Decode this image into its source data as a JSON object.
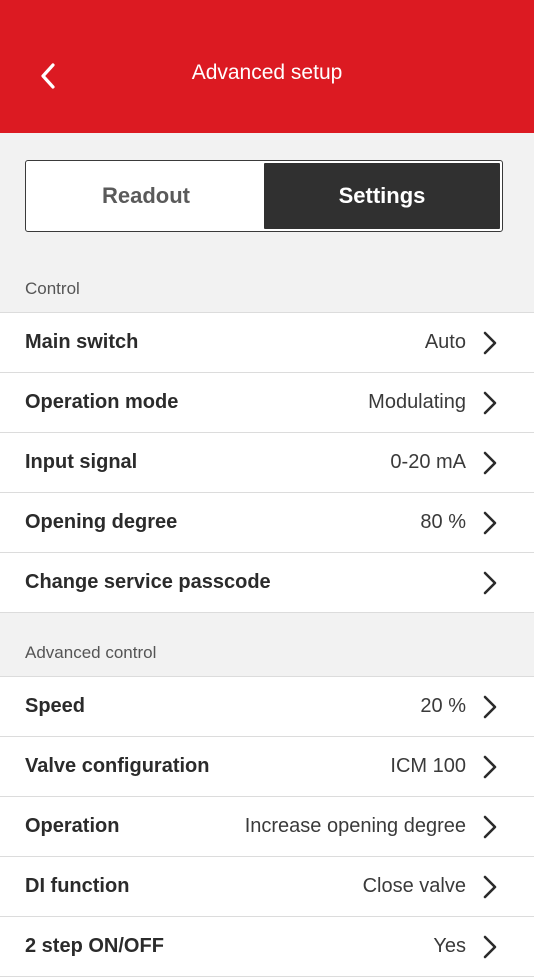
{
  "header": {
    "title": "Advanced setup"
  },
  "tabs": [
    {
      "label": "Readout",
      "active": false
    },
    {
      "label": "Settings",
      "active": true
    }
  ],
  "sections": {
    "control": {
      "title": "Control",
      "items": [
        {
          "label": "Main switch",
          "value": "Auto"
        },
        {
          "label": "Operation mode",
          "value": "Modulating"
        },
        {
          "label": "Input signal",
          "value": "0-20 mA"
        },
        {
          "label": "Opening degree",
          "value": "80 %"
        },
        {
          "label": "Change service passcode",
          "value": ""
        }
      ]
    },
    "advanced": {
      "title": "Advanced control",
      "items": [
        {
          "label": "Speed",
          "value": "20 %"
        },
        {
          "label": "Valve configuration",
          "value": "ICM 100"
        },
        {
          "label": "Operation",
          "value": "Increase opening degree"
        },
        {
          "label": "DI function",
          "value": "Close valve"
        },
        {
          "label": "2 step ON/OFF",
          "value": "Yes"
        }
      ]
    }
  },
  "colors": {
    "brand": "#dc1a22",
    "active_tab": "#303030"
  },
  "icons": {
    "back": "chevron-left-icon",
    "row": "chevron-right-icon"
  }
}
